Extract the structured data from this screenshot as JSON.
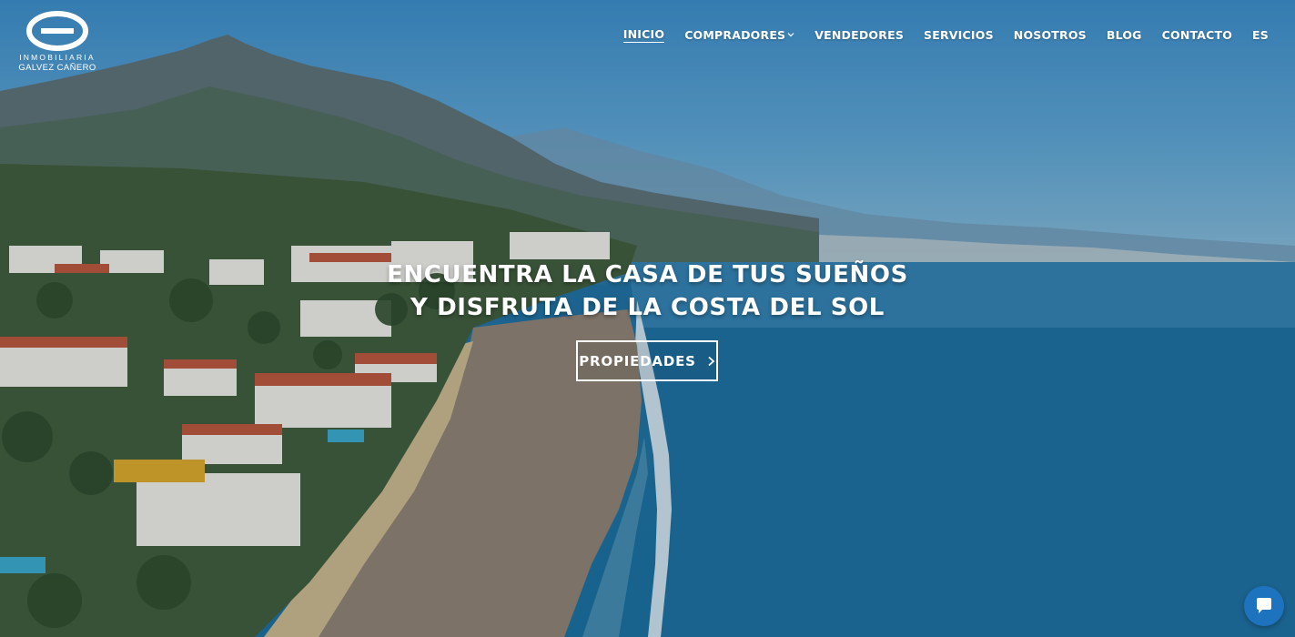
{
  "brand": {
    "line1": "INMOBILIARIA",
    "line2": "GALVEZ CAÑERO"
  },
  "nav": {
    "items": [
      {
        "label": "INICIO",
        "active": true
      },
      {
        "label": "COMPRADORES",
        "dropdown": true
      },
      {
        "label": "VENDEDORES"
      },
      {
        "label": "SERVICIOS"
      },
      {
        "label": "NOSOTROS"
      },
      {
        "label": "BLOG"
      },
      {
        "label": "CONTACTO"
      },
      {
        "label": "ES"
      }
    ]
  },
  "hero": {
    "headline_line1": "ENCUENTRA LA CASA DE TUS SUEÑOS",
    "headline_line2": "Y DISFRUTA DE LA COSTA DEL SOL",
    "cta_label": "PROPIEDADES"
  },
  "colors": {
    "accent": "#ffffff",
    "chat": "#1e73be",
    "sea": "#1a6798"
  },
  "icons": {
    "logo": "gc-logo-icon",
    "dropdown": "chevron-down-icon",
    "cta": "chevron-right-icon",
    "chat": "chat-bubble-icon"
  }
}
